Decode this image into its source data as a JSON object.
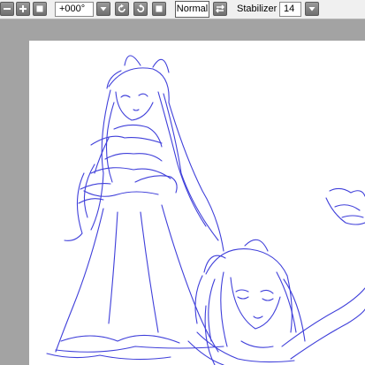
{
  "toolbar": {
    "buttons": [
      {
        "name": "zoom-out-icon"
      },
      {
        "name": "zoom-in-icon"
      },
      {
        "name": "reset-zoom-icon"
      },
      {
        "name": "angle-dropdown-icon"
      },
      {
        "name": "rotate-left-icon"
      },
      {
        "name": "rotate-right-icon"
      },
      {
        "name": "reset-rotation-icon"
      },
      {
        "name": "flip-horizontal-icon"
      },
      {
        "name": "stabilizer-dropdown-icon"
      }
    ],
    "rotation_value": "+000°",
    "blend_mode": "Normal",
    "stabilizer_label": "Stabilizer",
    "stabilizer_value": "14"
  },
  "canvas": {
    "paper_color": "#ffffff",
    "workspace_color": "#a3a3a3",
    "ink_color": "#2b2bd6"
  }
}
